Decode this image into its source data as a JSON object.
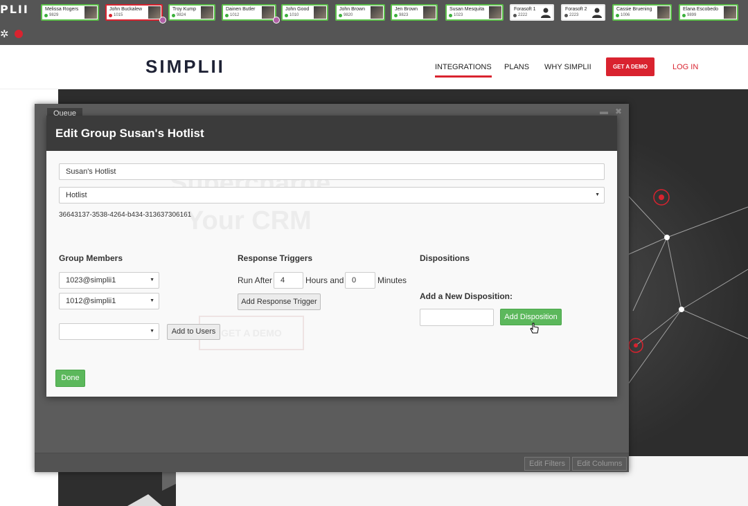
{
  "topbar": {
    "logo_fragment": "PLII",
    "contacts": [
      {
        "name": "Melissa Rogers",
        "ext": "9829",
        "status": "green"
      },
      {
        "name": "John Buckalew",
        "ext": "1015",
        "status": "red"
      },
      {
        "name": "Troy Kump",
        "ext": "9824",
        "status": "green"
      },
      {
        "name": "Dainen Butler",
        "ext": "1012",
        "status": "green"
      },
      {
        "name": "John Good",
        "ext": "1010",
        "status": "green"
      },
      {
        "name": "John Brown",
        "ext": "9820",
        "status": "green"
      },
      {
        "name": "Jen Brown",
        "ext": "9823",
        "status": "green"
      },
      {
        "name": "Susan Mesquita",
        "ext": "1023",
        "status": "green"
      },
      {
        "name": "Forasoft 1",
        "ext": "2222",
        "status": "grey"
      },
      {
        "name": "Forasoft 2",
        "ext": "2223",
        "status": "grey"
      },
      {
        "name": "Cassie Bruening",
        "ext": "1006",
        "status": "green"
      },
      {
        "name": "Elana Escobedo",
        "ext": "9899",
        "status": "green"
      }
    ]
  },
  "site": {
    "brand": "SIMPLII",
    "nav": {
      "integrations": "INTEGRATIONS",
      "plans": "PLANS",
      "why": "WHY SIMPLII",
      "demo": "GET A DEMO",
      "login": "LOG IN"
    },
    "hero": {
      "headline_1": "Supercharge",
      "headline_2": "Your CRM",
      "cta": "GET A DEMO"
    }
  },
  "queue": {
    "tab": "Queue",
    "edit_filters": "Edit Filters",
    "edit_columns": "Edit Columns"
  },
  "modal": {
    "title": "Edit Group Susan's Hotlist",
    "group_name": "Susan's Hotlist",
    "group_type": "Hotlist",
    "group_id": "36643137-3538-4264-b434-313637306161",
    "members_heading": "Group Members",
    "members": [
      "1023@simplii1",
      "1012@simplii1"
    ],
    "new_member": "",
    "add_to_users": "Add to Users",
    "triggers_heading": "Response Triggers",
    "run_after": "Run After",
    "hours_value": "4",
    "hours_and": "Hours and",
    "minutes_value": "0",
    "minutes": "Minutes",
    "add_trigger": "Add Response Trigger",
    "dispositions_heading": "Dispositions",
    "add_new_disposition": "Add a New Disposition:",
    "disposition_value": "",
    "add_disposition": "Add Disposition",
    "done": "Done"
  },
  "colors": {
    "accent_red": "#d9232f",
    "green": "#5cb85c",
    "dark": "#3b3b3b"
  }
}
